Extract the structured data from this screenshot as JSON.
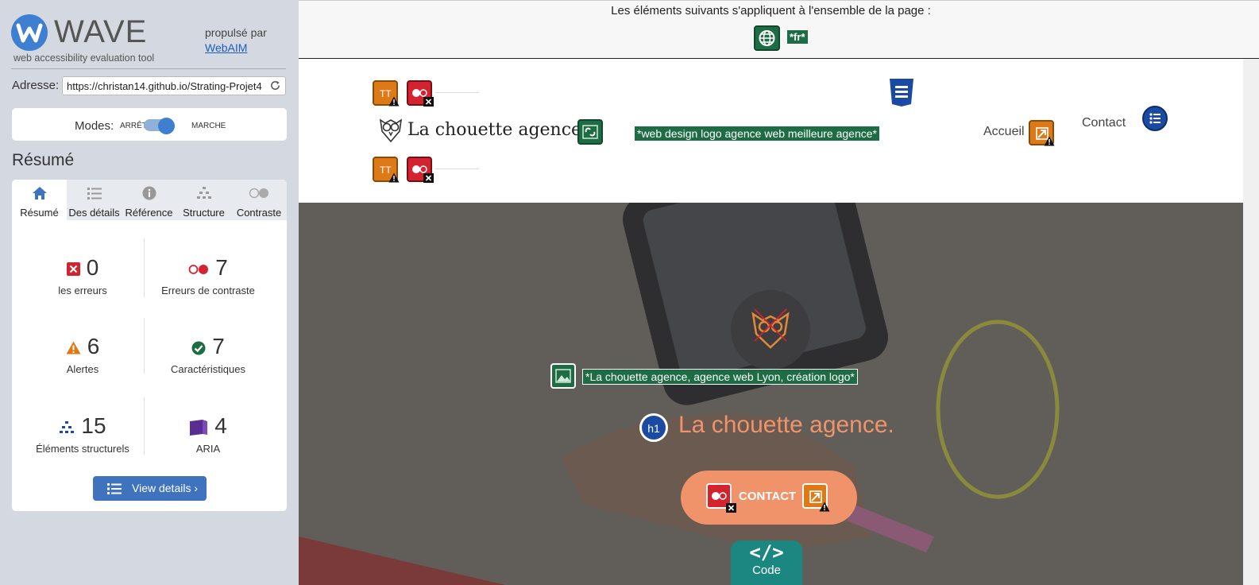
{
  "sidebar": {
    "app_title": "WAVE",
    "app_subtitle": "web accessibility evaluation tool",
    "powered_by": "propulsé par",
    "powered_link": "WebAIM",
    "address_label": "Adresse:",
    "address_value": "https://christan14.github.io/Strating-Projet4",
    "modes_label": "Modes:",
    "mode_off": "ARRÊT",
    "mode_on": "MARCHE",
    "section_title": "Résumé",
    "tabs": [
      {
        "label": "Résumé",
        "icon": "home-icon"
      },
      {
        "label": "Des détails",
        "icon": "list-icon"
      },
      {
        "label": "Référence",
        "icon": "info-icon"
      },
      {
        "label": "Structure",
        "icon": "hierarchy-icon"
      },
      {
        "label": "Contraste",
        "icon": "contrast-icon"
      }
    ],
    "stats": [
      {
        "value": "0",
        "label": "les erreurs",
        "icon": "error-icon",
        "color": "#d3232e"
      },
      {
        "value": "7",
        "label": "Erreurs de contraste",
        "icon": "contrast-error-icon",
        "color": "#d3232e"
      },
      {
        "value": "6",
        "label": "Alertes",
        "icon": "alert-icon",
        "color": "#dd7a17"
      },
      {
        "value": "7",
        "label": "Caractéristiques",
        "icon": "feature-icon",
        "color": "#1d6c43"
      },
      {
        "value": "15",
        "label": "Éléments structurels",
        "icon": "structure-icon",
        "color": "#1a4aa2"
      },
      {
        "value": "4",
        "label": "ARIA",
        "icon": "aria-icon",
        "color": "#5a2d91"
      }
    ],
    "view_details": "View details ›"
  },
  "main": {
    "topbar_text": "Les éléments suivants s'appliquent à l'ensemble de la page :",
    "lang_tag": "*fr*",
    "logo_name": "La chouette agence",
    "logo_alt": "*web design logo agence web meilleure agence*",
    "nav": {
      "home": "Accueil",
      "contact": "Contact"
    },
    "hero_alt": "*La chouette agence, agence web Lyon, création logo*",
    "heading_badge": "h1",
    "hero_title": "La chouette agence.",
    "cta_label": "CONTACT",
    "code_symbol": "</>",
    "code_label": "Code"
  },
  "colors": {
    "accent": "#3f7fd1",
    "hero_title": "#f0936a",
    "feature_green": "#1d6c43",
    "alert_orange": "#dd7a17",
    "error_red": "#d3232e",
    "structure_blue": "#1a4aa2"
  }
}
